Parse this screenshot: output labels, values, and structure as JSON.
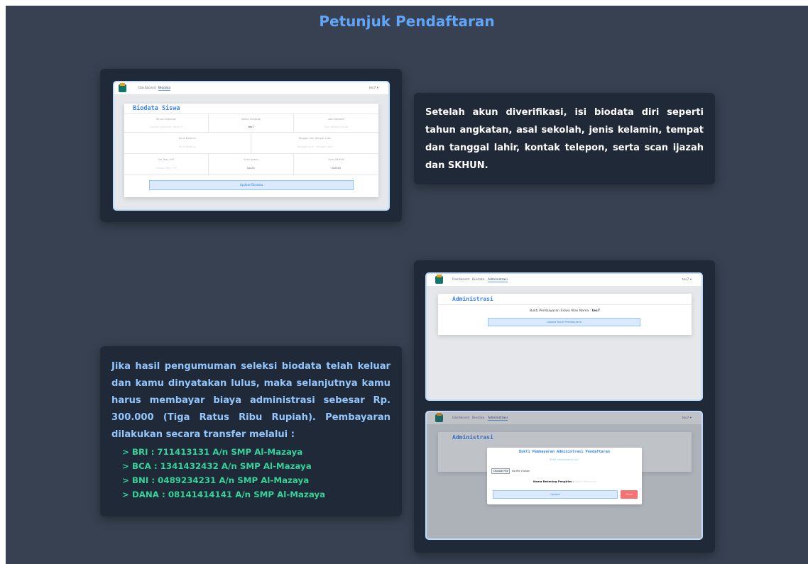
{
  "heading": "Petunjuk Pendaftaran",
  "step1": {
    "text": "Setelah akun diverifikasi, isi biodata diri seperti tahun angkatan, asal sekolah, jenis kelamin, tempat dan tanggal lahir, kontak telepon, serta scan ijazah dan SKHUN.",
    "shot": {
      "nav": [
        "Dashboard",
        "Biodata"
      ],
      "user": "tes7 ▾",
      "panel_title": "Biodata Siswa",
      "row1": [
        {
          "label": "Tahun Angkatan",
          "value": "Contoh Angkatan: Tahun 1"
        },
        {
          "label": "Nama Lengkap",
          "value": "tes7"
        },
        {
          "label": "Asal Sekolah",
          "value": "Asal Sekolah Anda"
        }
      ],
      "row2": [
        {
          "label": "Jenis Kelamin",
          "value": "Jenis Kelamin"
        },
        {
          "label": "Tanggal dan Tempat Lahir",
          "value": "Tanggal Lahir · Tempat Lahir"
        }
      ],
      "row3": [
        {
          "label": "No Telp / HP",
          "value": "Contoh Telp / HP"
        },
        {
          "label": "Scan Ijazah",
          "value": "Ijazah"
        },
        {
          "label": "Scan SKHUN",
          "value": "SKHUN"
        }
      ],
      "button": "Update Biodata"
    }
  },
  "step2": {
    "text": "Jika hasil pengumuman seleksi biodata telah keluar dan kamu dinyatakan lulus, maka selanjutnya kamu harus membayar biaya administrasi sebesar Rp. 300.000 (Tiga Ratus Ribu Rupiah). Pembayaran dilakukan secara transfer melalui :",
    "banks": [
      "> BRI : 711413131 A/n SMP Al-Mazaya",
      "> BCA : 1341432432 A/n SMP Al-Mazaya",
      "> BNI : 0489234231 A/n SMP Al-Mazaya",
      "> DANA : 08141414141 A/n SMP Al-Mazaya"
    ],
    "shot_a": {
      "nav": [
        "Dashboard",
        "Biodata",
        "Administrasi"
      ],
      "user": "tes7 ▾",
      "panel_title": "Administrasi",
      "caption_prefix": "Bukti Pembayaran Siswa Atas Nama : ",
      "caption_name": "tes7",
      "button": "Upload Bukti Pembayaran"
    },
    "shot_b": {
      "nav": [
        "Dashboard",
        "Biodata",
        "Administrasi"
      ],
      "user": "tes7 ▾",
      "panel_title": "Administrasi",
      "modal_title": "Bukti Pembayaran Administrasi Pendaftaran",
      "modal_sub": "Bukti pembayaran tes7",
      "choose_file": "Choose File",
      "no_file": "No file chosen",
      "rek_label": "Nama Rekening Pengirim :",
      "rek_placeholder": "Nama Rekening",
      "upload": "Upload",
      "close": "Close"
    }
  }
}
